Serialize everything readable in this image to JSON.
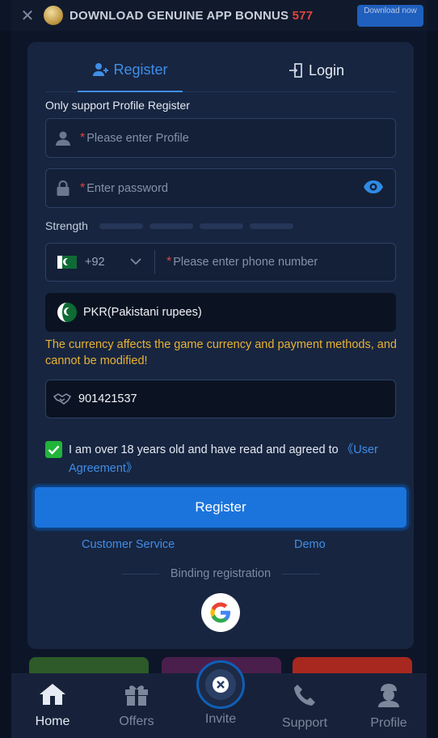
{
  "banner": {
    "title": "DOWNLOAD  GENUINE APP BONNUS ",
    "title_number": "577",
    "download_label": "Download now"
  },
  "tabs": {
    "register": "Register",
    "login": "Login"
  },
  "form": {
    "only_support_label": "Only support Profile Register",
    "profile_placeholder": "Please enter Profile",
    "password_placeholder": "Enter password",
    "strength_label": "Strength",
    "phone_code": "+92",
    "phone_placeholder": "Please enter phone number",
    "currency_value": "PKR(Pakistani rupees)",
    "currency_warning": "The currency affects the game currency and payment methods, and cannot be modified!",
    "invite_code_value": "901421537",
    "agree_text": "I am over 18 years old and have read and agreed to ",
    "agree_link": "《User Agreement》",
    "agree_checked": true,
    "required_mark": "*"
  },
  "actions": {
    "register_button": "Register",
    "customer_service": "Customer Service",
    "demo": "Demo",
    "binding_registration": "Binding registration"
  },
  "bottom_nav": {
    "items": [
      {
        "label": "Home",
        "icon": "home-icon",
        "active": true
      },
      {
        "label": "Offers",
        "icon": "gift-icon",
        "active": false
      },
      {
        "label": "Invite",
        "icon": "invite-icon",
        "active": false
      },
      {
        "label": "Support",
        "icon": "phone-icon",
        "active": false
      },
      {
        "label": "Profile",
        "icon": "user-icon",
        "active": false
      }
    ]
  },
  "colors": {
    "accent": "#3f8ee8",
    "button": "#1b74dc",
    "warning": "#e8b233",
    "checkbox": "#21b43a",
    "required": "#d9473f"
  }
}
